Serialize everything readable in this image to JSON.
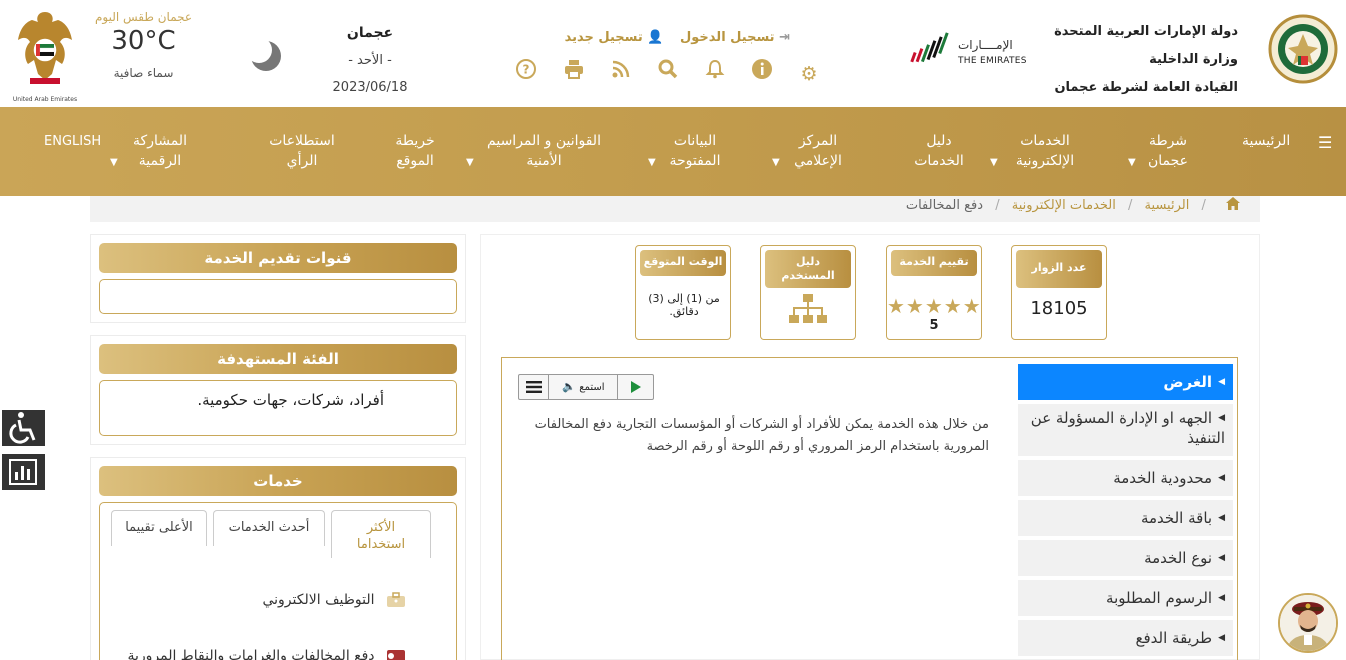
{
  "header": {
    "gov_line1": "دولة الإمارات العربية المتحدة",
    "gov_line2": "وزارة الداخلية",
    "gov_line3": "القيادة العامة لشرطة عجمان",
    "brand_ar": "الإمــــارات",
    "brand_en": "THE EMIRATES",
    "login": "تسجيل الدخول",
    "register": "تسجيل جديد",
    "city": "عجمان",
    "weekday": "- الأحد -",
    "date": "2023/06/18",
    "weather_title": "عجمان طقس اليوم",
    "temperature": "30°C",
    "sky": "سماء صافية",
    "uae_caption": "United Arab Emirates",
    "tools": [
      "settings-icon",
      "info-icon",
      "bell-icon",
      "search-icon",
      "rss-icon",
      "print-icon",
      "help-icon"
    ]
  },
  "nav": {
    "home": "الرئيسية",
    "police_l1": "شرطة",
    "police_l2": "عجمان",
    "eservices_l1": "الخدمات",
    "eservices_l2": "الإلكترونية",
    "guide_l1": "دليل",
    "guide_l2": "الخدمات",
    "media_l1": "المركز",
    "media_l2": "الإعلامي",
    "open_l1": "البيانات",
    "open_l2": "المفتوحة",
    "laws_l1": "القوانين و المراسيم",
    "laws_l2": "الأمنية",
    "sitemap_l1": "خريطة",
    "sitemap_l2": "الموقع",
    "polls_l1": "استطلاعات",
    "polls_l2": "الرأي",
    "digital_l1": "المشاركة",
    "digital_l2": "الرقمية",
    "english": "ENGLISH"
  },
  "breadcrumb": {
    "home": "الرئيسية",
    "section": "الخدمات الإلكترونية",
    "current": "دفع المخالفات"
  },
  "sidebar": {
    "channels_title": "قنوات تقديم الخدمة",
    "audience_title": "الفئة المستهدفة",
    "audience_text": "أفراد، شركات، جهات حكومية.",
    "services_title": "خدمات",
    "tab_most_used_l1": "الأكثر",
    "tab_most_used_l2": "استخداما",
    "tab_latest": "أحدث الخدمات",
    "tab_top_rated": "الأعلى تقييما",
    "item1": "التوظيف الالكتروني",
    "item2": "دفع المخالفات والغرامات والنقاط المرورية"
  },
  "stats": {
    "visitors_label": "عدد الزوار",
    "visitors_value": "18105",
    "rating_label": "تقييم الخدمة",
    "rating_stars": "★★★★★",
    "rating_value": "5",
    "guide_label_l1": "دليل",
    "guide_label_l2": "المستخدم",
    "time_label": "الوقت المتوقع",
    "time_value": "من (1) إلى (3) دقائق."
  },
  "details": {
    "items": [
      "الغرض",
      "الجهه او الإدارة المسؤولة عن التنفيذ",
      "محدودية الخدمة",
      "باقة الخدمة",
      "نوع الخدمة",
      "الرسوم المطلوبة",
      "طريقة الدفع"
    ],
    "listen": "استمع",
    "purpose_text": "من خلال هذه الخدمة يمكن للأفراد أو الشركات أو المؤسسات التجارية دفع المخالفات المرورية باستخدام الرمز المروري أو رقم اللوحة أو رقم الرخصة"
  },
  "colors": {
    "gold": "#c9a85a",
    "active_blue": "#0c86ff"
  }
}
